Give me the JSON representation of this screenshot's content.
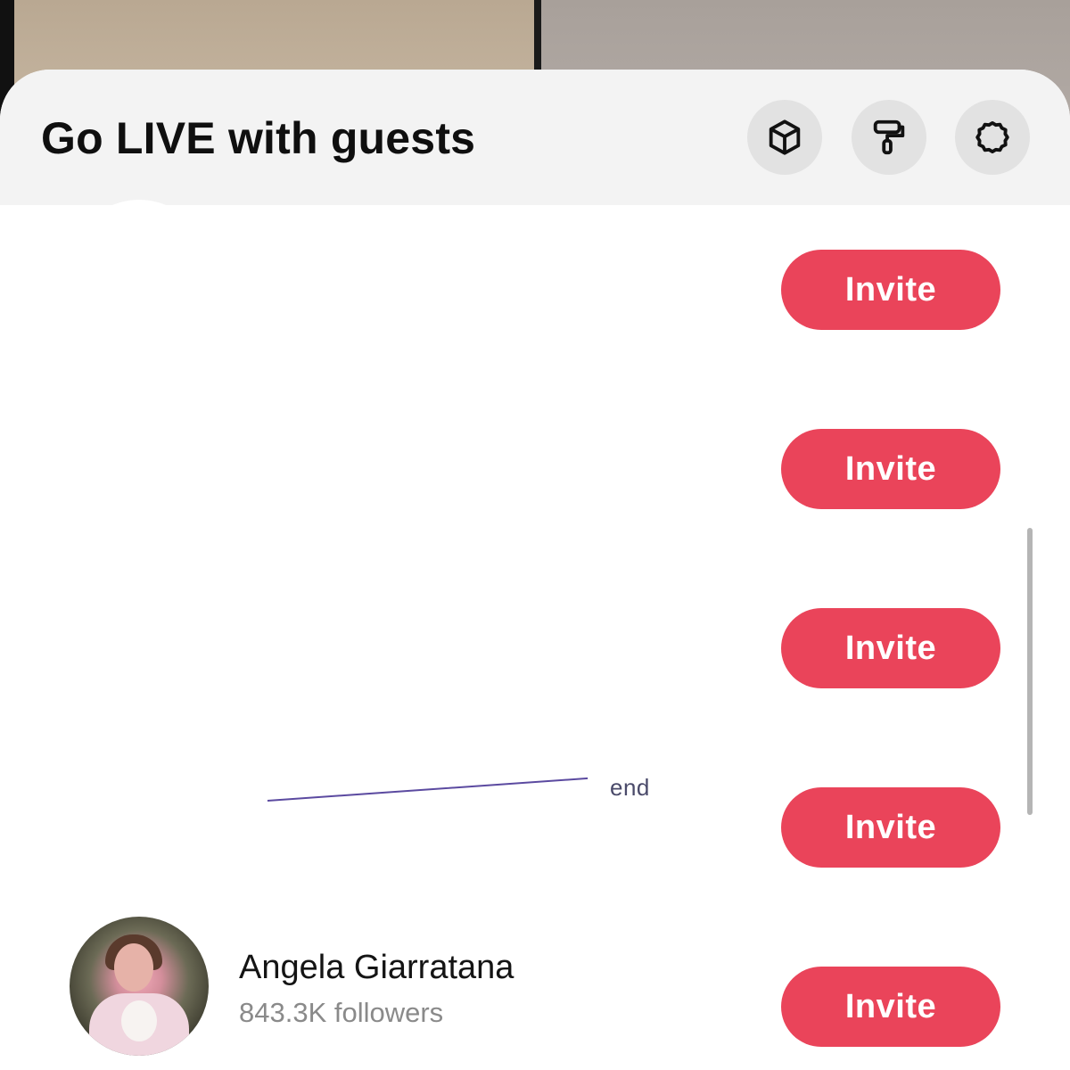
{
  "sheet": {
    "title": "Go LIVE with guests",
    "header_icons": [
      "cube-icon",
      "paint-roller-icon",
      "settings-icon"
    ]
  },
  "guests": [
    {
      "name": "",
      "followers": "",
      "redacted": true,
      "invite_label": "Invite"
    },
    {
      "name": "",
      "followers": "",
      "redacted": true,
      "invite_label": "Invite"
    },
    {
      "name": "",
      "followers": "",
      "redacted": true,
      "invite_label": "Invite"
    },
    {
      "name": "",
      "followers": "",
      "redacted": true,
      "invite_label": "Invite",
      "visible_fragment": "end"
    },
    {
      "name": "Angela Giarratana",
      "followers": "843.3K followers",
      "redacted": false,
      "invite_label": "Invite"
    }
  ],
  "colors": {
    "invite_button": "#ea445a",
    "header_background": "#f3f3f3",
    "icon_button_background": "#e2e2e2",
    "follower_text": "#8a8a8a"
  }
}
